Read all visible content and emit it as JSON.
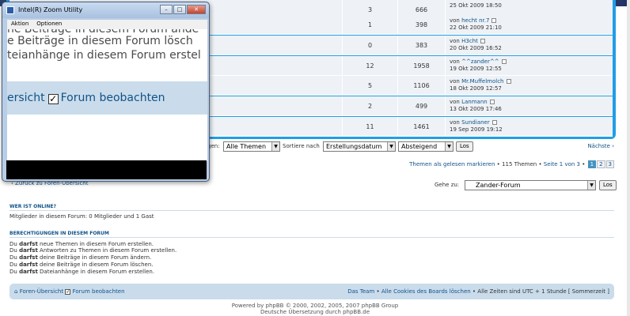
{
  "topics": [
    {
      "replies": "3",
      "views": "666",
      "by_prefix": "",
      "author": "",
      "date": "25 Okt 2009 18:50"
    },
    {
      "replies": "1",
      "views": "398",
      "by_prefix": "von",
      "author": "hecht nr.7",
      "date": "22 Okt 2009 21:10"
    },
    {
      "replies": "0",
      "views": "383",
      "by_prefix": "von",
      "author": "H3cht",
      "date": "20 Okt 2009 16:52"
    },
    {
      "replies": "12",
      "views": "1958",
      "by_prefix": "von",
      "author": "^^zander^^",
      "date": "19 Okt 2009 12:55"
    },
    {
      "replies": "5",
      "views": "1106",
      "by_prefix": "von",
      "author": "Mr.Muffelmolch",
      "date": "18 Okt 2009 12:57"
    },
    {
      "replies": "2",
      "views": "499",
      "by_prefix": "von",
      "author": "Lanmann",
      "date": "13 Okt 2009 17:46"
    },
    {
      "replies": "11",
      "views": "1461",
      "by_prefix": "von",
      "author": "Sundianer",
      "date": "19 Sep 2009 19:12"
    }
  ],
  "sortbar": {
    "show_label_partial": "gen:",
    "show_value": "Alle Themen",
    "sort_label": "Sortiere nach",
    "sort_value": "Erstellungsdatum",
    "order_value": "Absteigend",
    "go_label": "Los",
    "next_label": "Nächste"
  },
  "pagination": {
    "mark_read": "Themen als gelesen markieren",
    "topic_count": "115 Themen",
    "page_text": "Seite 1 von 3",
    "pages": [
      "1",
      "2",
      "3"
    ]
  },
  "back_link": "Zurück zu Foren-Übersicht",
  "jump": {
    "label": "Gehe zu:",
    "value": "Zander-Forum",
    "go_label": "Los"
  },
  "whos_online": {
    "title": "WER IST ONLINE?",
    "text": "Mitglieder in diesem Forum: 0 Mitglieder und 1 Gast"
  },
  "permissions": {
    "title": "BERECHTIGUNGEN IN DIESEM FORUM",
    "lines": [
      {
        "pre": "Du",
        "bold": "darfst",
        "post": "neue Themen in diesem Forum erstellen."
      },
      {
        "pre": "Du",
        "bold": "darfst",
        "post": "Antworten zu Themen in diesem Forum erstellen."
      },
      {
        "pre": "Du",
        "bold": "darfst",
        "post": "deine Beiträge in diesem Forum ändern."
      },
      {
        "pre": "Du",
        "bold": "darfst",
        "post": "deine Beiträge in diesem Forum löschen."
      },
      {
        "pre": "Du",
        "bold": "darfst",
        "post": "Dateianhänge in diesem Forum erstellen."
      }
    ]
  },
  "navbar": {
    "home": "Foren-Übersicht",
    "watch": "Forum beobachten",
    "team": "Das Team",
    "delete_cookies": "Alle Cookies des Boards löschen",
    "timezone": "Alle Zeiten sind UTC + 1 Stunde [ Sommerzeit ]"
  },
  "footer": {
    "powered": "Powered by phpBB © 2000, 2002, 2005, 2007 phpBB Group",
    "translation": "Deutsche Übersetzung durch phpBB.de"
  },
  "zoom_window": {
    "title": "Intel(R) Zoom Utility",
    "menu": [
      "Aktion",
      "Optionen"
    ],
    "text_lines": [
      "ne Beiträge in diesem Forum ände",
      "e Beiträge in diesem Forum lösch",
      "teianhänge in diesem Forum erstel"
    ],
    "band_text_left": "ersicht",
    "band_text_right": "Forum beobachten",
    "check_mark": "✓"
  },
  "colors": {
    "accent": "#1f9ee6",
    "link": "#105289",
    "row_bg": "#eef2f6",
    "band": "#cadceb"
  }
}
